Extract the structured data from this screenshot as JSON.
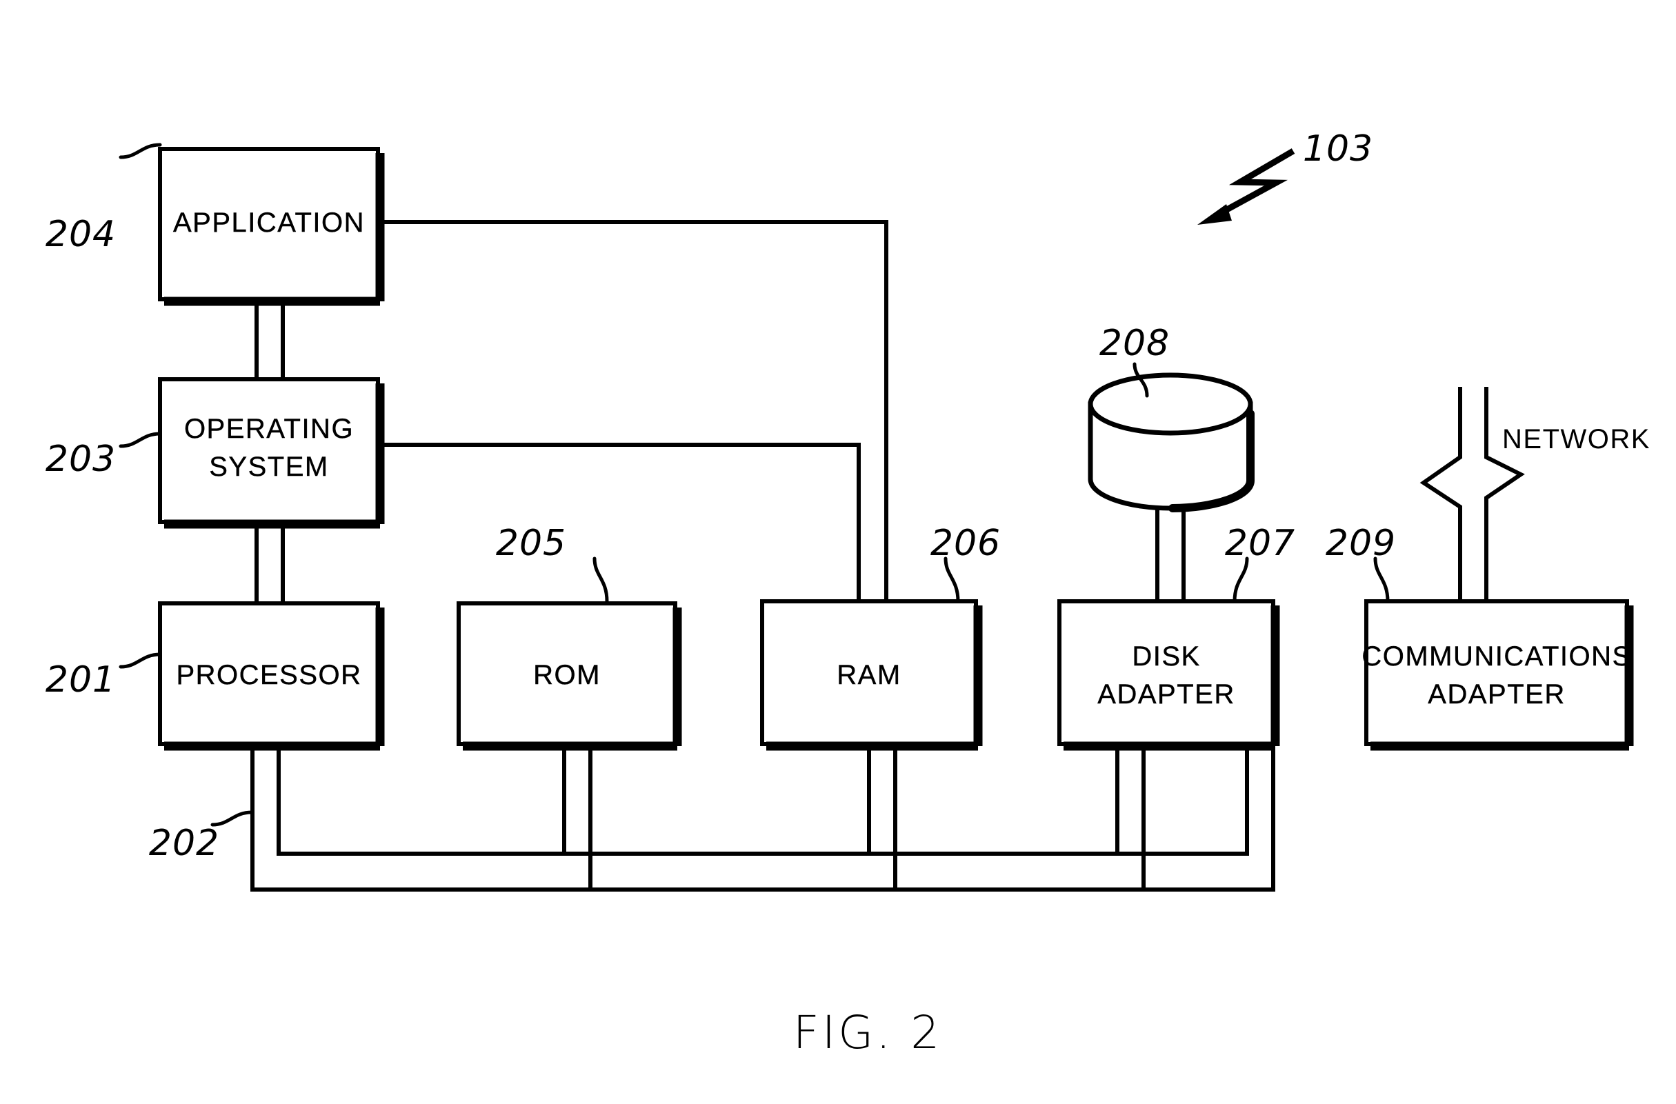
{
  "figure": {
    "caption": "FIG. 2",
    "overall_ref": "103",
    "network_label": "NETWORK"
  },
  "blocks": [
    {
      "id": "application",
      "label": "APPLICATION",
      "ref": "204"
    },
    {
      "id": "operating-system",
      "label_line1": "OPERATING",
      "label_line2": "SYSTEM",
      "ref": "203"
    },
    {
      "id": "processor",
      "label": "PROCESSOR",
      "ref": "201"
    },
    {
      "id": "rom",
      "label": "ROM",
      "ref": "205"
    },
    {
      "id": "ram",
      "label": "RAM",
      "ref": "206"
    },
    {
      "id": "disk-adapter",
      "label_line1": "DISK",
      "label_line2": "ADAPTER",
      "ref": "207"
    },
    {
      "id": "communications-adapter",
      "label_line1": "COMMUNICATIONS",
      "label_line2": "ADAPTER",
      "ref": "209"
    },
    {
      "id": "disk",
      "label": "",
      "ref": "208"
    }
  ],
  "bus": {
    "id": "system-bus",
    "ref": "202"
  },
  "refs": {
    "r201": "201",
    "r202": "202",
    "r203": "203",
    "r204": "204",
    "r205": "205",
    "r206": "206",
    "r207": "207",
    "r208": "208",
    "r209": "209",
    "r103": "103"
  },
  "labels": {
    "application": "APPLICATION",
    "operating_system_1": "OPERATING",
    "operating_system_2": "SYSTEM",
    "processor": "PROCESSOR",
    "rom": "ROM",
    "ram": "RAM",
    "disk_adapter_1": "DISK",
    "disk_adapter_2": "ADAPTER",
    "comm_adapter_1": "COMMUNICATIONS",
    "comm_adapter_2": "ADAPTER",
    "network": "NETWORK",
    "caption": "FIG. 2"
  },
  "colors": {
    "ink": "#000000",
    "paper": "#ffffff"
  }
}
